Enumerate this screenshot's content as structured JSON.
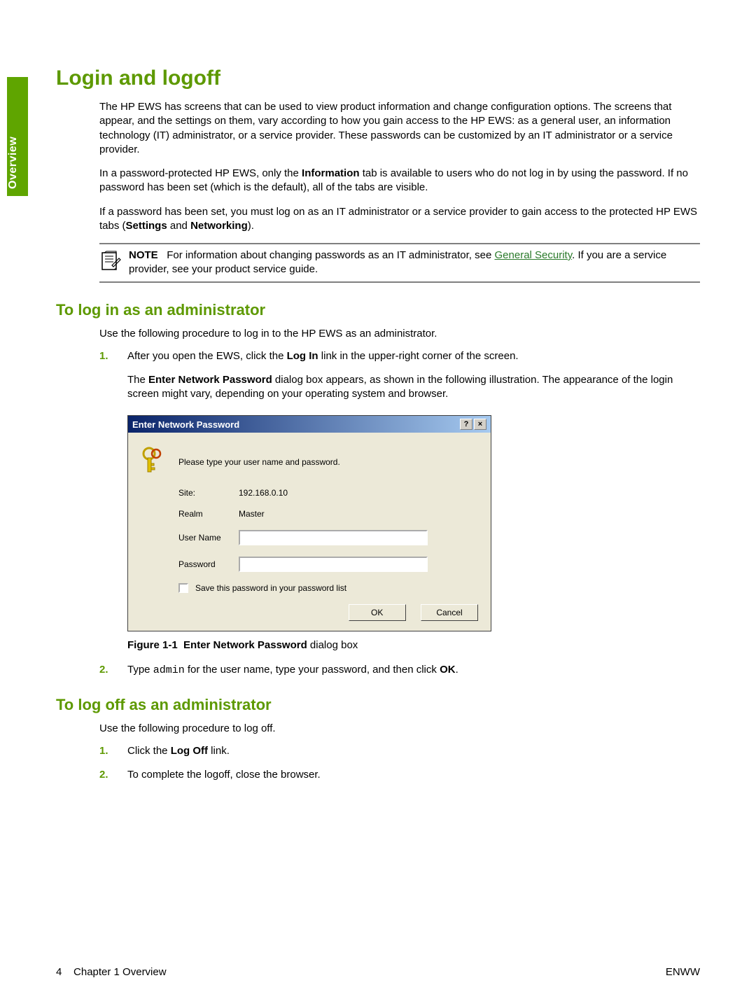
{
  "sideTab": "Overview",
  "title": "Login and logoff",
  "intro": {
    "p1": "The HP EWS has screens that can be used to view product information and change configuration options. The screens that appear, and the settings on them, vary according to how you gain access to the HP EWS: as a general user, an information technology (IT) administrator, or a service provider. These passwords can be customized by an IT administrator or a service provider.",
    "p2a": "In a password-protected HP EWS, only the ",
    "p2b": "Information",
    "p2c": " tab is available to users who do not log in by using the password. If no password has been set (which is the default), all of the tabs are visible.",
    "p3a": "If a password has been set, you must log on as an IT administrator or a service provider to gain access to the protected HP EWS tabs (",
    "p3b": "Settings",
    "p3c": " and ",
    "p3d": "Networking",
    "p3e": ")."
  },
  "note": {
    "label": "NOTE",
    "texta": "For information about changing passwords as an IT administrator, see ",
    "link": "General Security",
    "textb": ". If you are a service provider, see your product service guide."
  },
  "login": {
    "heading": "To log in as an administrator",
    "intro": "Use the following procedure to log in to the HP EWS as an administrator.",
    "step1a": "After you open the EWS, click the ",
    "step1b": "Log In",
    "step1c": " link in the upper-right corner of the screen.",
    "step1suba": "The ",
    "step1subb": "Enter Network Password",
    "step1subc": " dialog box appears, as shown in the following illustration. The appearance of the login screen might vary, depending on your operating system and browser.",
    "step2a": "Type ",
    "step2b": "admin",
    "step2c": " for the user name, type your password, and then click ",
    "step2d": "OK",
    "step2e": "."
  },
  "dialog": {
    "title": "Enter Network Password",
    "help": "?",
    "close": "×",
    "prompt": "Please type your user name and password.",
    "siteLabel": "Site:",
    "siteValue": "192.168.0.10",
    "realmLabel": "Realm",
    "realmValue": "Master",
    "userLabel": "User Name",
    "passLabel": "Password",
    "saveLabel": "Save this password in your password list",
    "ok": "OK",
    "cancel": "Cancel"
  },
  "caption": {
    "fig": "Figure 1-1",
    "bold": "Enter Network Password",
    "rest": " dialog box"
  },
  "logoff": {
    "heading": "To log off as an administrator",
    "intro": "Use the following procedure to log off.",
    "step1a": "Click the ",
    "step1b": "Log Off",
    "step1c": " link.",
    "step2": "To complete the logoff, close the browser."
  },
  "footer": {
    "pageNum": "4",
    "chapter": "Chapter 1   Overview",
    "right": "ENWW"
  }
}
